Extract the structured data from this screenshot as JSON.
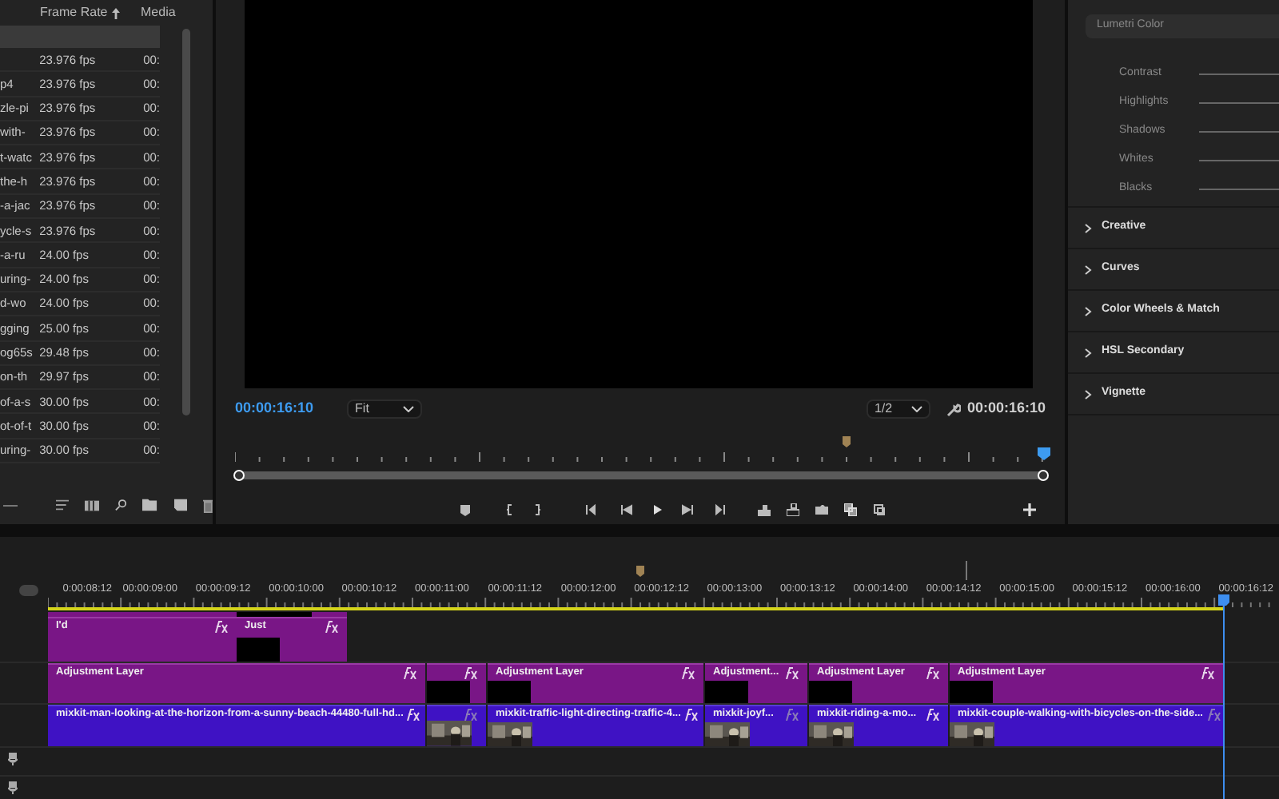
{
  "project": {
    "columns": [
      "Frame Rate",
      "Media"
    ],
    "rows": [
      {
        "frame_rate": "23.976 fps",
        "media": "00:"
      },
      {
        "name": "p4",
        "frame_rate": "23.976 fps",
        "media": "00:"
      },
      {
        "name": "zle-pi",
        "frame_rate": "23.976 fps",
        "media": "00:"
      },
      {
        "name": "with-",
        "frame_rate": "23.976 fps",
        "media": "00:"
      },
      {
        "name": "t-watc",
        "frame_rate": "23.976 fps",
        "media": "00:"
      },
      {
        "name": "the-h",
        "frame_rate": "23.976 fps",
        "media": "00:"
      },
      {
        "name": "-a-jac",
        "frame_rate": "23.976 fps",
        "media": "00:"
      },
      {
        "name": "ycle-s",
        "frame_rate": "23.976 fps",
        "media": "00:"
      },
      {
        "name": "-a-ru",
        "frame_rate": "24.00 fps",
        "media": "00:"
      },
      {
        "name": "uring-",
        "frame_rate": "24.00 fps",
        "media": "00:"
      },
      {
        "name": "d-wo",
        "frame_rate": "24.00 fps",
        "media": "00:"
      },
      {
        "name": "gging",
        "frame_rate": "25.00 fps",
        "media": "00:"
      },
      {
        "name": "og65s",
        "frame_rate": "29.48 fps",
        "media": "00:"
      },
      {
        "name": "on-th",
        "frame_rate": "29.97 fps",
        "media": "00:"
      },
      {
        "name": "of-a-s",
        "frame_rate": "30.00 fps",
        "media": "00:"
      },
      {
        "name": "ot-of-t",
        "frame_rate": "30.00 fps",
        "media": "00:"
      },
      {
        "name": "uring-",
        "frame_rate": "30.00 fps",
        "media": "00:"
      }
    ]
  },
  "monitor": {
    "timecode": "00:00:16:10",
    "zoom": "Fit",
    "resolution": "1/2",
    "duration": "00:00:16:10"
  },
  "lumetri": {
    "effect": "Lumetri Color",
    "sliders": [
      "Contrast",
      "Highlights",
      "Shadows",
      "Whites",
      "Blacks"
    ],
    "sections": [
      {
        "label": "Creative",
        "expanded": false
      },
      {
        "label": "Curves",
        "expanded": false
      },
      {
        "label": "Color Wheels & Match",
        "expanded": false
      },
      {
        "label": "HSL Secondary",
        "expanded": false
      },
      {
        "label": "Vignette",
        "expanded": false
      }
    ]
  },
  "timeline": {
    "ruler": [
      "0:00:08:12",
      "00:00:09:00",
      "00:00:09:12",
      "00:00:10:00",
      "00:00:10:12",
      "00:00:11:00",
      "00:00:11:12",
      "00:00:12:00",
      "00:00:12:12",
      "00:00:13:00",
      "00:00:13:12",
      "00:00:14:00",
      "00:00:14:12",
      "00:00:15:00",
      "00:00:15:12",
      "00:00:16:00",
      "00:00:16:12"
    ],
    "tracks": [
      {
        "kind": "video",
        "clips": [
          {
            "kind": "plain",
            "label": "I'd",
            "fx_active": true
          },
          {
            "kind": "frame",
            "label": "Just",
            "fx_active": true
          }
        ]
      },
      {
        "kind": "video",
        "clips": [
          {
            "kind": "plain",
            "label": "Adjustment Layer",
            "fx_active": true
          },
          {
            "kind": "frame",
            "fx_active": true
          },
          {
            "kind": "frame",
            "label": "Adjustment Layer",
            "fx_active": true
          },
          {
            "kind": "frame",
            "label": "Adjustment...",
            "fx_active": true
          },
          {
            "kind": "frame",
            "label": "Adjustment Layer",
            "fx_active": true
          },
          {
            "kind": "frame",
            "label": "Adjustment Layer",
            "fx_active": true
          }
        ]
      },
      {
        "kind": "media",
        "clips": [
          {
            "kind": "plain",
            "label": "mixkit-man-looking-at-the-horizon-from-a-sunny-beach-44480-full-hd...",
            "fx_active": true
          },
          {
            "kind": "picture",
            "fx_active": false
          },
          {
            "kind": "picture",
            "label": "mixkit-traffic-light-directing-traffic-4...",
            "fx_active": true
          },
          {
            "kind": "picture",
            "label": "mixkit-joyf...",
            "fx_active": false
          },
          {
            "kind": "picture",
            "label": "mixkit-riding-a-mo...",
            "fx_active": true
          },
          {
            "kind": "picture",
            "label": "mixkit-couple-walking-with-bicycles-on-the-side...",
            "fx_active": false
          }
        ]
      },
      {
        "kind": "audio"
      },
      {
        "kind": "audio"
      }
    ]
  }
}
